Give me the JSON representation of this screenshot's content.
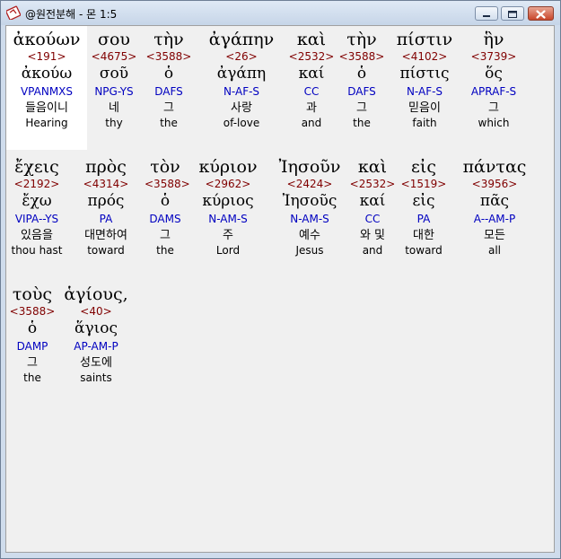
{
  "window": {
    "title": "@원전분해 - 몬 1:5",
    "icon": "bible-app-icon",
    "controls": [
      "minimize-icon",
      "maximize-icon",
      "close-icon"
    ]
  },
  "words": [
    {
      "greek": "ἀκούων",
      "strong": "<191>",
      "lemma": "ἀκούω",
      "morph": "VPANMXS",
      "korean": "들음이니",
      "english": "Hearing",
      "selected": true
    },
    {
      "greek": "σου",
      "strong": "<4675>",
      "lemma": "σοῦ",
      "morph": "NPG-YS",
      "korean": "네",
      "english": "thy"
    },
    {
      "greek": "τὴν",
      "strong": "<3588>",
      "lemma": "ὁ",
      "morph": "DAFS",
      "korean": "그",
      "english": "the"
    },
    {
      "greek": "ἀγάπην",
      "strong": "<26>",
      "lemma": "ἀγάπη",
      "morph": "N-AF-S",
      "korean": "사랑",
      "english": "of-love"
    },
    {
      "greek": "καὶ",
      "strong": "<2532>",
      "lemma": "καί",
      "morph": "CC",
      "korean": "과",
      "english": "and"
    },
    {
      "greek": "τὴν",
      "strong": "<3588>",
      "lemma": "ὁ",
      "morph": "DAFS",
      "korean": "그",
      "english": "the"
    },
    {
      "greek": "πίστιν",
      "strong": "<4102>",
      "lemma": "πίστις",
      "morph": "N-AF-S",
      "korean": "믿음이",
      "english": "faith"
    },
    {
      "greek": "ἣν",
      "strong": "<3739>",
      "lemma": "ὅς",
      "morph": "APRAF-S",
      "korean": "그",
      "english": "which"
    },
    {
      "greek": "ἔχεις",
      "strong": "<2192>",
      "lemma": "ἔχω",
      "morph": "VIPA--YS",
      "korean": "있음을",
      "english": "thou hast"
    },
    {
      "greek": "πρὸς",
      "strong": "<4314>",
      "lemma": "πρός",
      "morph": "PA",
      "korean": "대면하여",
      "english": "toward"
    },
    {
      "greek": "τὸν",
      "strong": "<3588>",
      "lemma": "ὁ",
      "morph": "DAMS",
      "korean": "그",
      "english": "the"
    },
    {
      "greek": "κύριον",
      "strong": "<2962>",
      "lemma": "κύριος",
      "morph": "N-AM-S",
      "korean": "주",
      "english": "Lord"
    },
    {
      "greek": "Ἰησοῦν",
      "strong": "<2424>",
      "lemma": "Ἰησοῦς",
      "morph": "N-AM-S",
      "korean": "예수",
      "english": "Jesus"
    },
    {
      "greek": "καὶ",
      "strong": "<2532>",
      "lemma": "καί",
      "morph": "CC",
      "korean": "와 및",
      "english": "and"
    },
    {
      "greek": "εἰς",
      "strong": "<1519>",
      "lemma": "εἰς",
      "morph": "PA",
      "korean": "대한",
      "english": "toward"
    },
    {
      "greek": "πάντας",
      "strong": "<3956>",
      "lemma": "πᾶς",
      "morph": "A--AM-P",
      "korean": "모든",
      "english": "all"
    },
    {
      "greek": "τοὺς",
      "strong": "<3588>",
      "lemma": "ὁ",
      "morph": "DAMP",
      "korean": "그",
      "english": "the"
    },
    {
      "greek": "ἁγίους,",
      "strong": "<40>",
      "lemma": "ἅγιος",
      "morph": "AP-AM-P",
      "korean": "성도에",
      "english": "saints"
    }
  ]
}
